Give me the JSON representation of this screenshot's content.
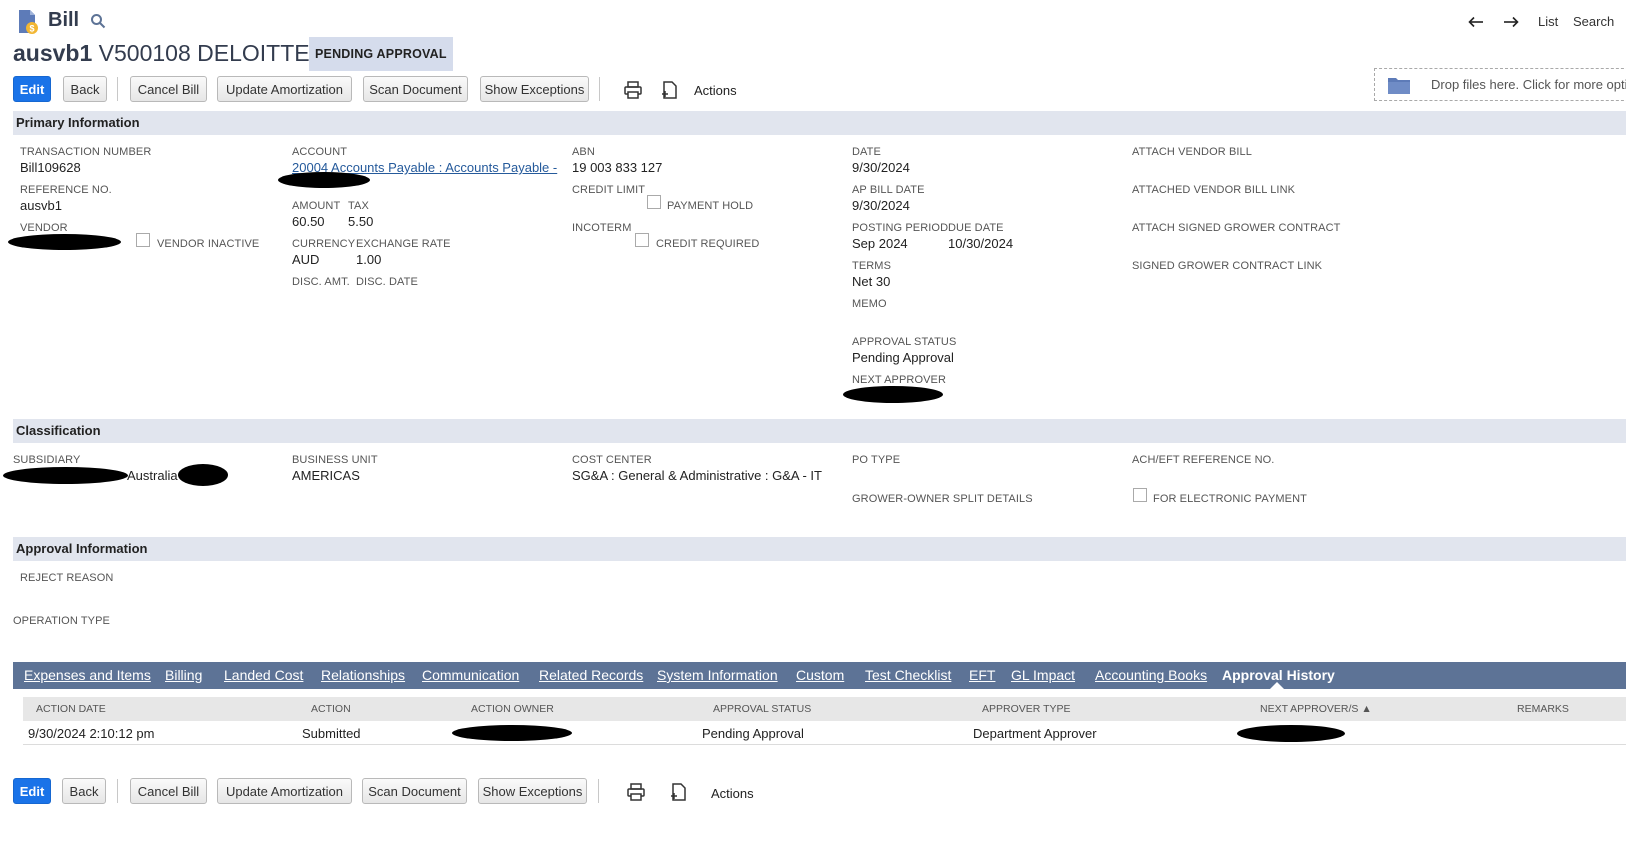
{
  "header": {
    "record_type": "Bill",
    "record_id": "ausvb1",
    "record_name": "V500108 DELOITTE",
    "status": "PENDING APPROVAL",
    "nav": {
      "list": "List",
      "search": "Search"
    }
  },
  "toolbar": {
    "edit": "Edit",
    "back": "Back",
    "cancel_bill": "Cancel Bill",
    "update_amortization": "Update Amortization",
    "scan_document": "Scan Document",
    "show_exceptions": "Show Exceptions",
    "actions": "Actions"
  },
  "dropzone": {
    "text": "Drop files here. Click for more options."
  },
  "primary": {
    "title": "Primary Information",
    "transaction_number": {
      "label": "TRANSACTION NUMBER",
      "value": "Bill109628"
    },
    "reference_no": {
      "label": "REFERENCE NO.",
      "value": "ausvb1"
    },
    "vendor": {
      "label": "VENDOR",
      "value": ""
    },
    "vendor_inactive": {
      "label": "VENDOR INACTIVE"
    },
    "account": {
      "label": "ACCOUNT",
      "value": "20004 Accounts Payable : Accounts Payable -"
    },
    "amount": {
      "label": "AMOUNT",
      "value": "60.50"
    },
    "tax": {
      "label": "TAX",
      "value": "5.50"
    },
    "currency": {
      "label": "CURRENCY",
      "value": "AUD"
    },
    "exchange_rate": {
      "label": "EXCHANGE RATE",
      "value": "1.00"
    },
    "disc_amt": {
      "label": "DISC. AMT."
    },
    "disc_date": {
      "label": "DISC. DATE"
    },
    "abn": {
      "label": "ABN",
      "value": "19 003 833 127"
    },
    "credit_limit": {
      "label": "CREDIT LIMIT"
    },
    "payment_hold": {
      "label": "PAYMENT HOLD"
    },
    "incoterm": {
      "label": "INCOTERM"
    },
    "credit_required": {
      "label": "CREDIT REQUIRED"
    },
    "date": {
      "label": "DATE",
      "value": "9/30/2024"
    },
    "ap_bill_date": {
      "label": "AP BILL DATE",
      "value": "9/30/2024"
    },
    "posting_period": {
      "label": "POSTING PERIOD",
      "value": "Sep 2024"
    },
    "due_date": {
      "label": "DUE DATE",
      "value": "10/30/2024"
    },
    "terms": {
      "label": "TERMS",
      "value": "Net 30"
    },
    "memo": {
      "label": "MEMO"
    },
    "approval_status": {
      "label": "APPROVAL STATUS",
      "value": "Pending Approval"
    },
    "next_approver": {
      "label": "NEXT APPROVER"
    },
    "attach_vendor_bill": {
      "label": "ATTACH VENDOR BILL"
    },
    "attached_vendor_bill_link": {
      "label": "ATTACHED VENDOR BILL LINK"
    },
    "attach_signed_grower_contract": {
      "label": "ATTACH SIGNED GROWER CONTRACT"
    },
    "signed_grower_contract_link": {
      "label": "SIGNED GROWER CONTRACT LINK"
    }
  },
  "classification": {
    "title": "Classification",
    "subsidiary": {
      "label": "SUBSIDIARY",
      "value": "Australia"
    },
    "business_unit": {
      "label": "BUSINESS UNIT",
      "value": "AMERICAS"
    },
    "cost_center": {
      "label": "COST CENTER",
      "value": "SG&A : General & Administrative : G&A - IT"
    },
    "po_type": {
      "label": "PO TYPE"
    },
    "grower_owner_split": {
      "label": "GROWER-OWNER SPLIT DETAILS"
    },
    "ach_eft_ref": {
      "label": "ACH/EFT REFERENCE NO."
    },
    "for_electronic_payment": {
      "label": "FOR ELECTRONIC PAYMENT"
    }
  },
  "approval": {
    "title": "Approval Information",
    "reject_reason": {
      "label": "REJECT REASON"
    },
    "operation_type": {
      "label": "OPERATION TYPE"
    }
  },
  "tabs": [
    {
      "label": "Expenses and Items"
    },
    {
      "label": "Billing"
    },
    {
      "label": "Landed Cost"
    },
    {
      "label": "Relationships"
    },
    {
      "label": "Communication"
    },
    {
      "label": "Related Records"
    },
    {
      "label": "System Information"
    },
    {
      "label": "Custom"
    },
    {
      "label": "Test Checklist"
    },
    {
      "label": "EFT"
    },
    {
      "label": "GL Impact"
    },
    {
      "label": "Accounting Books"
    },
    {
      "label": "Approval History"
    }
  ],
  "history": {
    "columns": {
      "action_date": "ACTION DATE",
      "action": "ACTION",
      "action_owner": "ACTION OWNER",
      "approval_status": "APPROVAL STATUS",
      "approver_type": "APPROVER TYPE",
      "next_approvers": "NEXT APPROVER/S ▲",
      "remarks": "REMARKS"
    },
    "rows": [
      {
        "action_date": "9/30/2024 2:10:12 pm",
        "action": "Submitted",
        "approval_status": "Pending Approval",
        "approver_type": "Department Approver"
      }
    ]
  }
}
